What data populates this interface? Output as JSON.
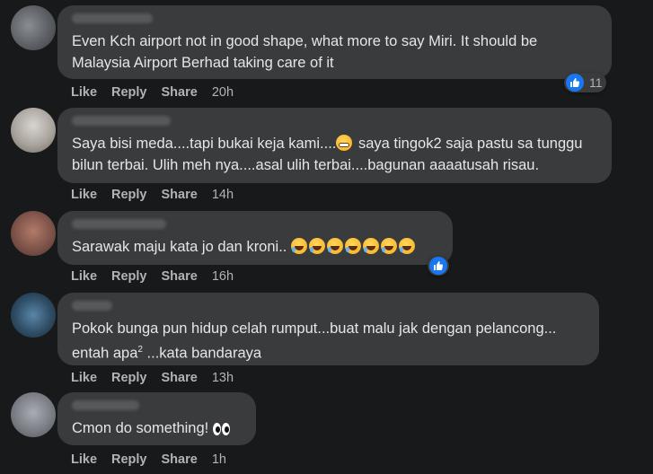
{
  "comments": [
    {
      "text_lines": [
        "Even Kch airport not in good shape, what more to say Miri. It should be",
        "Malaysia Airport Berhad taking care of it"
      ],
      "like": "Like",
      "reply": "Reply",
      "share": "Share",
      "time": "20h",
      "reaction_count": "11"
    },
    {
      "text_lines": [
        "Saya bisi meda....tapi bukai keja kami....",
        " saya tingok2 saja pastu sa tunggu",
        "bilun terbai. Ulih meh nya....asal ulih terbai....bagunan aaaatusah risau."
      ],
      "like": "Like",
      "reply": "Reply",
      "share": "Share",
      "time": "14h"
    },
    {
      "text": "Sarawak maju kata jo dan kroni.. ",
      "like": "Like",
      "reply": "Reply",
      "share": "Share",
      "time": "16h"
    },
    {
      "text_lines": [
        "Pokok bunga pun hidup celah rumput...buat malu jak dengan pelancong...",
        "entah apa",
        "2",
        " ...kata bandaraya"
      ],
      "like": "Like",
      "reply": "Reply",
      "share": "Share",
      "time": "13h"
    },
    {
      "text": "Cmon do something! ",
      "like": "Like",
      "reply": "Reply",
      "share": "Share",
      "time": "1h"
    }
  ],
  "icons": {
    "like_badge": "thumbs-up-icon",
    "laugh_emoji": "laughing-crying-emoji-icon",
    "grimace_emoji": "grimacing-emoji-icon",
    "eyes_emoji": "eyes-emoji-icon"
  },
  "colors": {
    "background": "#18191a",
    "bubble": "#3a3b3c",
    "text": "#e4e6eb",
    "secondary_text": "#b0b3b8",
    "like_blue": "#1877f2"
  }
}
